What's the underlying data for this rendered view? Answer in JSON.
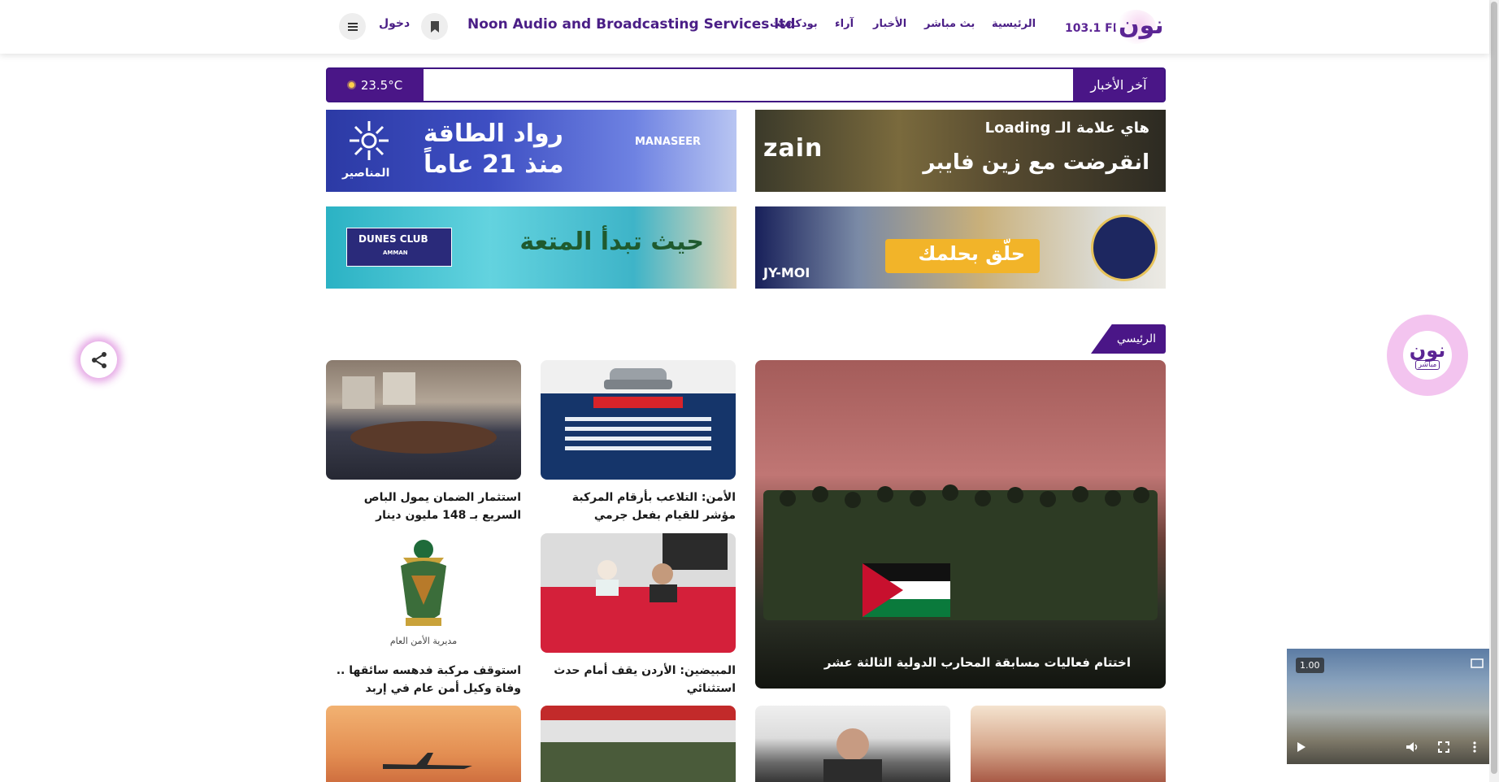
{
  "header": {
    "logo_fm": "103.1 FM",
    "logo_mark": "نون",
    "nav": [
      "الرئيسية",
      "بث مباشر",
      "الأخبار",
      "آراء",
      "بودكاست"
    ],
    "brand": "Noon Audio and Broadcasting Services ltd",
    "login": "دخول",
    "bookmark_icon": "bookmark-icon",
    "menu_icon": "menu-icon"
  },
  "ticker": {
    "label": "آخر الأخبار",
    "temperature": "23.5°C",
    "weather_icon": "sun-icon"
  },
  "banners": {
    "zain": {
      "line1": "هاي علامة الـ Loading",
      "line2": "انقرضت مع زين فايبر",
      "brand": "zain"
    },
    "manaseer": {
      "line1": "رواد الطاقة",
      "line2": "منذ 21 عاماً",
      "brand": "MANASEER",
      "sub": "المناصير"
    },
    "midEast": {
      "text": "حلّق بحلمك",
      "tag": "JY-MOI"
    },
    "dunes": {
      "text": "حيث تبدأ المتعة",
      "brand": "DUNES CLUB",
      "sub": "AMMAN"
    }
  },
  "section": {
    "label": "الرئيسي"
  },
  "news": {
    "featured": "اختتام فعاليات مسابقة المحارب الدولية الثالثة عشر",
    "c1": "الأمن: التلاعب بأرقام المركبة مؤشر للقيام بفعل جرمي",
    "c2": "استثمار الضمان يمول الباص السريع بـ 148 مليون دينار",
    "c3": "المبيضين: الأردن يقف أمام حدث استثنائي",
    "c4": "استوقف مركبة فدهسه سائقها .. وفاة وكيل أمن عام في إربد"
  },
  "live_button": {
    "label": "مباشر",
    "mark": "نون"
  },
  "player": {
    "speed": "1.00"
  },
  "colors": {
    "brand_purple": "#4a1687",
    "accent_pink": "#f3c4ef"
  }
}
